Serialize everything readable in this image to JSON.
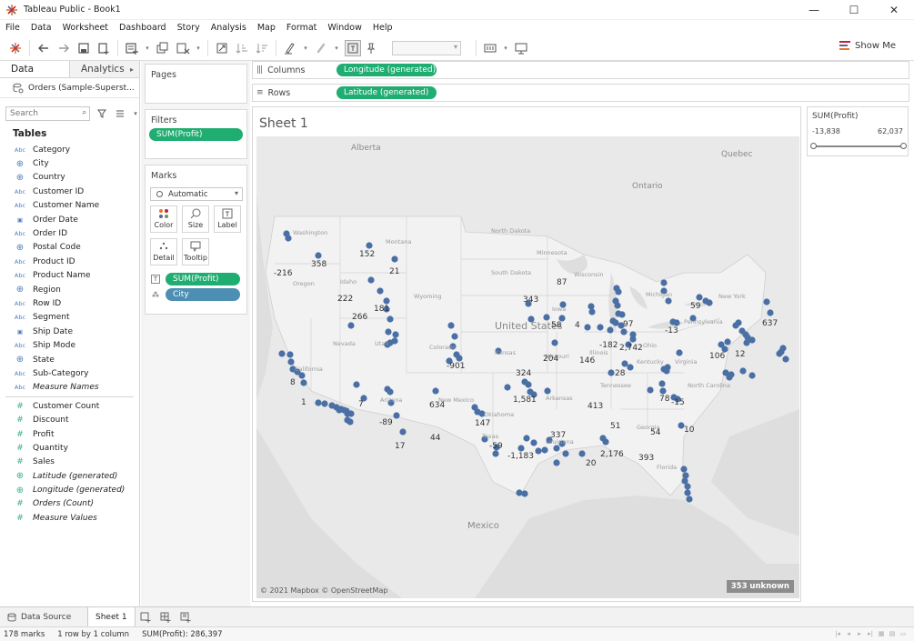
{
  "window": {
    "title": "Tableau Public - Book1",
    "controls": [
      "—",
      "☐",
      "✕"
    ]
  },
  "menu": [
    "File",
    "Data",
    "Worksheet",
    "Dashboard",
    "Story",
    "Analysis",
    "Map",
    "Format",
    "Window",
    "Help"
  ],
  "toolbar": {
    "show_me": "Show Me"
  },
  "data_pane": {
    "tabs": [
      "Data",
      "Analytics"
    ],
    "datasource": "Orders (Sample-Superst...",
    "search_placeholder": "Search",
    "tables_header": "Tables",
    "dimensions": [
      {
        "type": "Abc",
        "name": "Category"
      },
      {
        "type": "geo",
        "name": "City"
      },
      {
        "type": "geo",
        "name": "Country"
      },
      {
        "type": "Abc",
        "name": "Customer ID"
      },
      {
        "type": "Abc",
        "name": "Customer Name"
      },
      {
        "type": "date",
        "name": "Order Date"
      },
      {
        "type": "Abc",
        "name": "Order ID"
      },
      {
        "type": "geo",
        "name": "Postal Code"
      },
      {
        "type": "Abc",
        "name": "Product ID"
      },
      {
        "type": "Abc",
        "name": "Product Name"
      },
      {
        "type": "geo",
        "name": "Region"
      },
      {
        "type": "Abc",
        "name": "Row ID"
      },
      {
        "type": "Abc",
        "name": "Segment"
      },
      {
        "type": "date",
        "name": "Ship Date"
      },
      {
        "type": "Abc",
        "name": "Ship Mode"
      },
      {
        "type": "geo",
        "name": "State"
      },
      {
        "type": "Abc",
        "name": "Sub-Category"
      },
      {
        "type": "Abc",
        "name": "Measure Names",
        "italic": true
      }
    ],
    "measures": [
      {
        "type": "#",
        "name": "Customer Count"
      },
      {
        "type": "#",
        "name": "Discount"
      },
      {
        "type": "#",
        "name": "Profit"
      },
      {
        "type": "#",
        "name": "Quantity"
      },
      {
        "type": "#",
        "name": "Sales"
      },
      {
        "type": "geo",
        "name": "Latitude (generated)",
        "italic": true
      },
      {
        "type": "geo",
        "name": "Longitude (generated)",
        "italic": true
      },
      {
        "type": "#",
        "name": "Orders (Count)",
        "italic": true
      },
      {
        "type": "#",
        "name": "Measure Values",
        "italic": true
      }
    ]
  },
  "cards": {
    "pages_title": "Pages",
    "filters_title": "Filters",
    "filter_pill": "SUM(Profit)",
    "marks_title": "Marks",
    "mark_type": "Automatic",
    "mark_buttons": [
      "Color",
      "Size",
      "Label",
      "Detail",
      "Tooltip"
    ],
    "mark_fields": [
      "SUM(Profit)",
      "City"
    ]
  },
  "shelves": {
    "columns_label": "Columns",
    "columns_pill": "Longitude (generated)",
    "rows_label": "Rows",
    "rows_pill": "Latitude (generated)"
  },
  "sheet": {
    "title": "Sheet 1",
    "credit": "© 2021 Mapbox © OpenStreetMap",
    "unknown": "353 unknown",
    "countries": [
      "Alberta",
      "Quebec",
      "Ontario",
      "Mexico"
    ],
    "states": [
      "Washington",
      "Montana",
      "North Dakota",
      "Minnesota",
      "South Dakota",
      "Oregon",
      "Idaho",
      "Wyoming",
      "Wisconsin",
      "Michigan",
      "New York",
      "Iowa",
      "Nevada",
      "Utah",
      "Colorado",
      "Kansas",
      "Missouri",
      "Illinois",
      "Ohio",
      "Pennsylvania",
      "California",
      "Kentucky",
      "Virginia",
      "Arizona",
      "New Mexico",
      "Oklahoma",
      "Arkansas",
      "Tennessee",
      "North Carolina",
      "Texas",
      "Louisiana",
      "Georgia",
      "Florida"
    ],
    "us_label": "United States",
    "profit_labels": [
      "-216",
      "358",
      "152",
      "21",
      "87",
      "343",
      "222",
      "266",
      "181",
      "58",
      "4",
      "97",
      "59",
      "637",
      "-182",
      "2,742",
      "-13",
      "106",
      "12",
      "-901",
      "204",
      "146",
      "28",
      "324",
      "8",
      "1",
      "7",
      "634",
      "1,581",
      "413",
      "78",
      "-15",
      "-89",
      "147",
      "337",
      "51",
      "54",
      "10",
      "17",
      "44",
      "-59",
      "-1,183",
      "20",
      "2,176",
      "393"
    ]
  },
  "legend": {
    "title": "SUM(Profit)",
    "min": "-13,838",
    "max": "62,037"
  },
  "bottom_tabs": {
    "datasource": "Data Source",
    "sheet": "Sheet 1"
  },
  "status": {
    "marks": "178 marks",
    "dims": "1 row by 1 column",
    "sum": "SUM(Profit): 286,397"
  },
  "colors": {
    "pill_green": "#1fad72",
    "pill_blue": "#4d8fb3",
    "dot": "#4a6fa5",
    "map_land": "#e9e9e9"
  }
}
